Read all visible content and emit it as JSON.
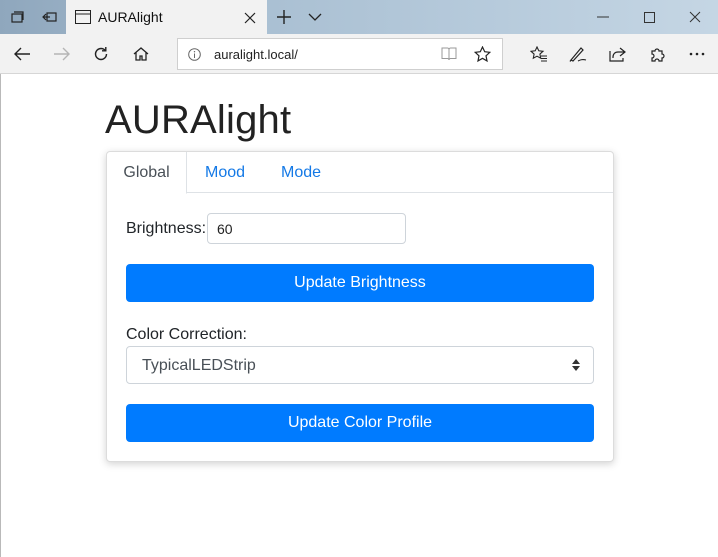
{
  "browser": {
    "tab_title": "AURAlight",
    "url": "auralight.local/",
    "new_tab_symbol": "+",
    "icons": [
      "tab-manager-icon",
      "back-tabs-icon",
      "page-icon",
      "close-icon",
      "new-tab-icon",
      "chevron-down-icon",
      "minimize-icon",
      "maximize-icon",
      "window-close-icon",
      "back-icon",
      "forward-icon",
      "refresh-icon",
      "home-icon",
      "info-icon",
      "reading-view-icon",
      "favorite-star-icon",
      "favorites-list-icon",
      "pen-icon",
      "share-icon",
      "extensions-icon",
      "more-icon"
    ]
  },
  "app": {
    "title": "AURAlight",
    "tabs": [
      {
        "label": "Global"
      },
      {
        "label": "Mood"
      },
      {
        "label": "Mode"
      }
    ],
    "brightness": {
      "label": "Brightness:",
      "value": "60",
      "button": "Update Brightness"
    },
    "color_correction": {
      "label": "Color Correction:",
      "selected": "TypicalLEDStrip",
      "button": "Update Color Profile"
    }
  },
  "colors": {
    "primary": "#007bff",
    "tab_link": "#1479e6"
  }
}
